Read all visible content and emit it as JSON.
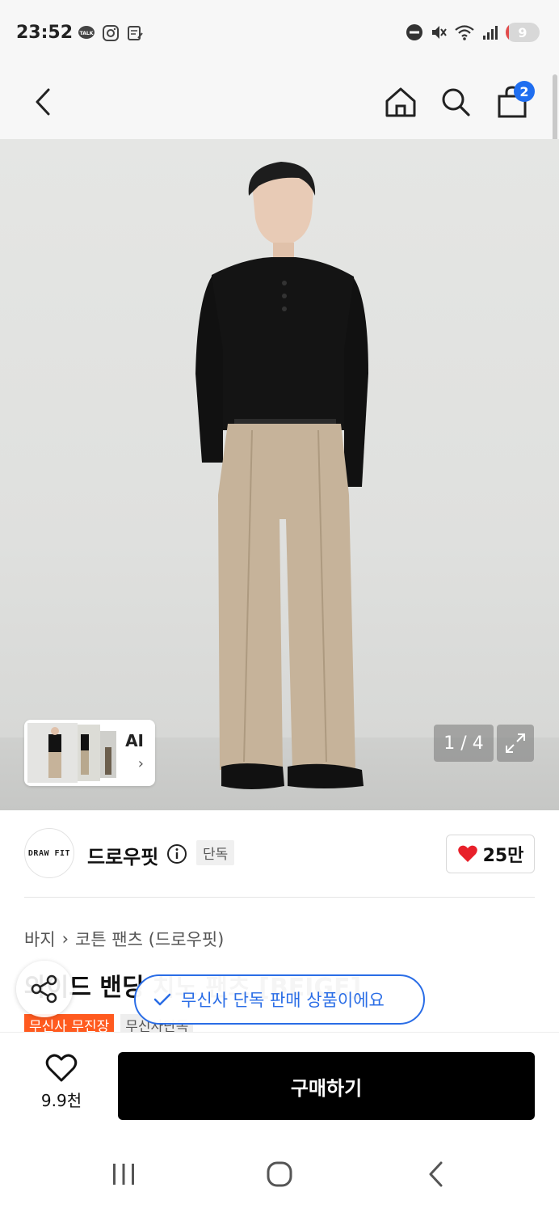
{
  "status_bar": {
    "time": "23:52",
    "battery_level": "9",
    "left_icons": [
      "talk-icon",
      "instagram-icon",
      "memo-icon"
    ],
    "right_icons": [
      "do-not-disturb-icon",
      "mute-icon",
      "wifi-icon",
      "signal-icon",
      "battery-icon"
    ]
  },
  "nav": {
    "cart_count": "2"
  },
  "hero": {
    "counter": "1 / 4",
    "ai_label": "AI",
    "ai_chevron": "›"
  },
  "brand": {
    "logo_text": "DRAW FIT",
    "name": "드로우핏",
    "exclusive_tag": "단독",
    "like_count": "25만"
  },
  "breadcrumb": {
    "category": "바지",
    "separator": "›",
    "subcategory": "코튼 팬츠 (드로우핏)"
  },
  "product": {
    "title": "와이드 밴딩 치노 팬츠 [BEIGE]",
    "tags": [
      "무신사 무진장",
      "무신사단독"
    ]
  },
  "toast": {
    "text": "무신사 단독 판매 상품이에요"
  },
  "bottom": {
    "wish_count": "9.9천",
    "buy_label": "구매하기"
  },
  "colors": {
    "accent_blue": "#2a6de6",
    "badge_blue": "#1f6ef0",
    "heart_red": "#e8202a",
    "tag_orange": "#ff5a1f"
  }
}
